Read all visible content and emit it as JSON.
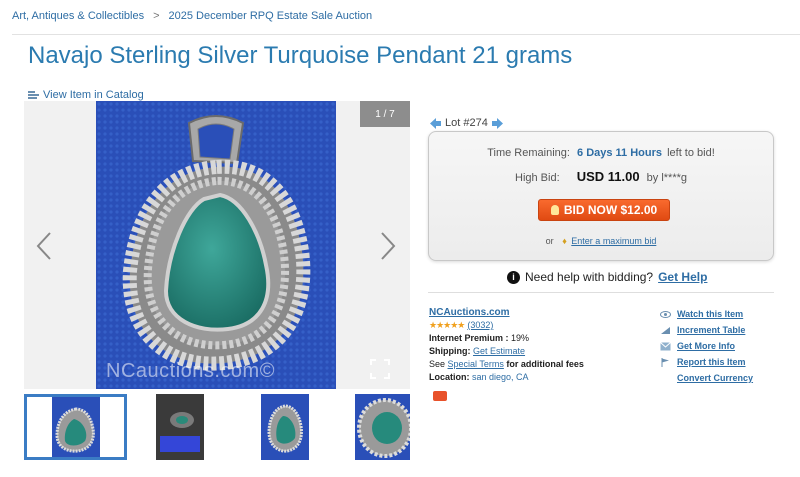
{
  "breadcrumb": {
    "items": [
      "Art, Antiques & Collectibles",
      "2025 December RPQ Estate Sale Auction"
    ],
    "separator": ">"
  },
  "page": {
    "title": "Navajo Sterling Silver Turquoise Pendant 21 grams",
    "catalog_link": "View Item in Catalog"
  },
  "gallery": {
    "counter": "1 / 7",
    "watermark": "NCauctions.com©",
    "prev_icon": "chevron-left-icon",
    "next_icon": "chevron-right-icon",
    "fullscreen_icon": "fullscreen-icon",
    "thumbnail_count": 4
  },
  "lot": {
    "label": "Lot #274",
    "prev_icon": "arrow-left-icon",
    "next_icon": "arrow-right-icon"
  },
  "bidding": {
    "time_label": "Time Remaining:",
    "time_value": "6 Days 11 Hours",
    "time_suffix": "left to bid!",
    "high_bid_label": "High Bid:",
    "high_bid_amount": "USD 11.00",
    "high_bid_by": "by l****g",
    "bid_button": "BID NOW $12.00",
    "or_text": "or",
    "max_bid_link": "Enter a maximum bid"
  },
  "help": {
    "text": "Need help with bidding?",
    "link": "Get Help"
  },
  "seller": {
    "name": "NCAuctions.com",
    "stars": "★★★★★",
    "rating_count": "(3032)",
    "premium_label": "Internet Premium :",
    "premium_value": "19%",
    "shipping_label": "Shipping:",
    "shipping_link": "Get Estimate",
    "see_text": "See",
    "special_terms": "Special Terms",
    "fees_text": "for additional fees",
    "location_label": "Location:",
    "location_value": "san diego, CA"
  },
  "actions": {
    "watch": "Watch this Item",
    "increment": "Increment Table",
    "more_info": "Get More Info",
    "report": "Report this Item",
    "currency": "Convert Currency"
  },
  "colors": {
    "link": "#2e6da4",
    "title": "#2b7bb0",
    "bid_button": "#f0541d",
    "photo_background": "#2a4fb8"
  }
}
